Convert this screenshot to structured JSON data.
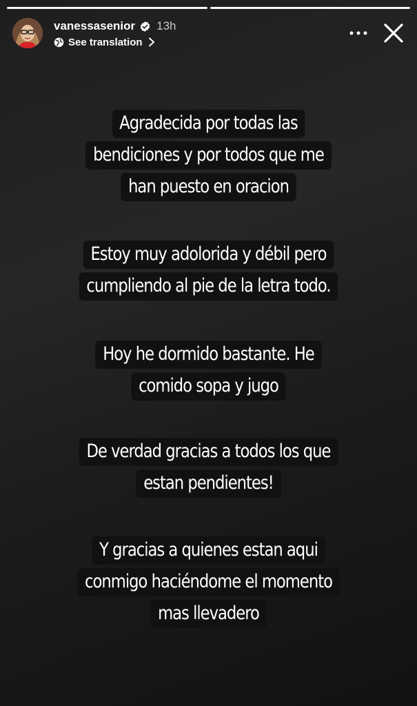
{
  "progress": [
    {
      "state": "complete",
      "fill": 1.0
    },
    {
      "state": "current",
      "fill": 1.0
    }
  ],
  "header": {
    "username": "vanessasenior",
    "verified": true,
    "time": "13h",
    "translation_link": "See translation",
    "icons": {
      "avatar": "profile-photo",
      "verified": "verified-badge-icon",
      "globe": "globe-icon",
      "chevron": "chevron-right-icon",
      "more": "more-options-icon",
      "close": "close-icon"
    }
  },
  "story_text": {
    "paragraphs": [
      {
        "lines": [
          "Agradecida por todas las",
          "bendiciones y por todos que me",
          "han  puesto en oracion"
        ]
      },
      {
        "lines": [
          "Estoy muy adolorida y débil pero",
          "cumpliendo al pie de la letra todo."
        ]
      },
      {
        "lines": [
          "Hoy he dormido bastante. He",
          "comido sopa y jugo"
        ]
      },
      {
        "lines": [
          "De verdad gracias a todos los que",
          "estan pendientes!"
        ]
      },
      {
        "lines": [
          "Y gracias a quienes estan aqui",
          "conmigo haciéndome el momento",
          "mas llevadero"
        ]
      }
    ]
  },
  "colors": {
    "background": "#1e1e1e",
    "text_highlight": "#111111",
    "text": "#ffffff"
  }
}
